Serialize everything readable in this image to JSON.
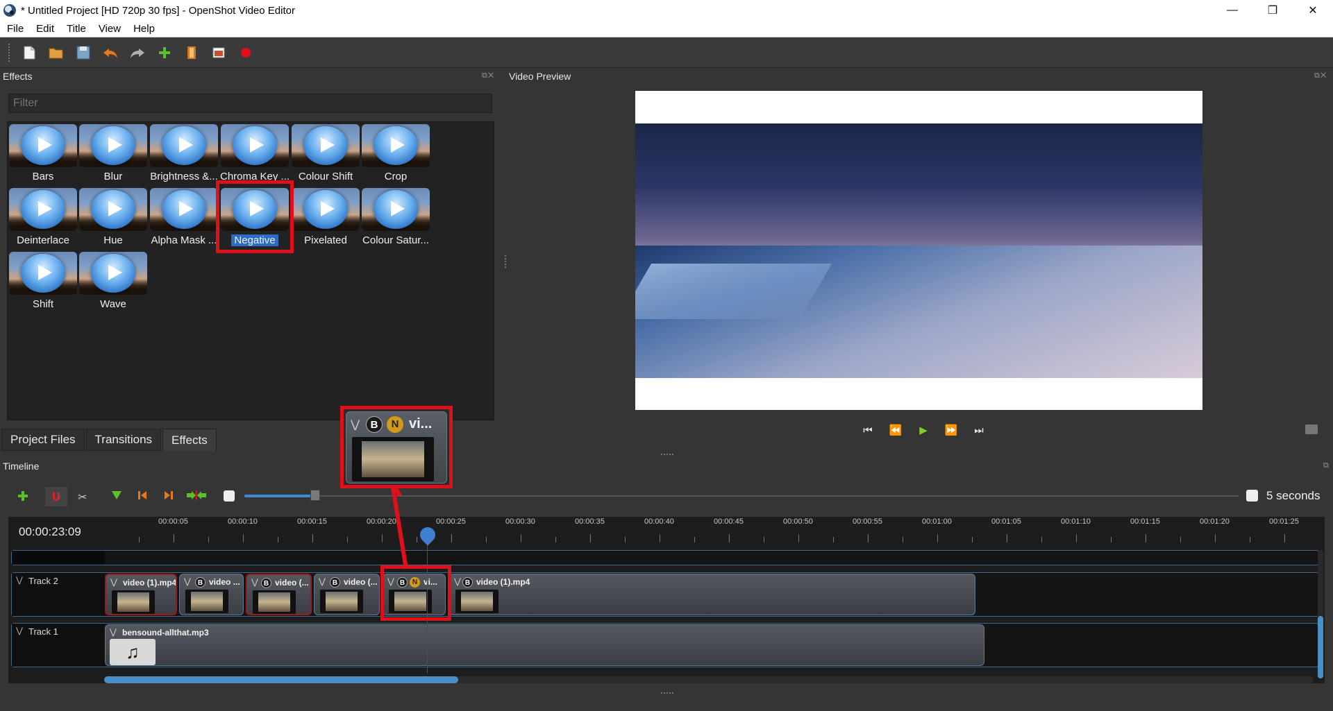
{
  "window": {
    "title": "* Untitled Project [HD 720p 30 fps] - OpenShot Video Editor",
    "controls": [
      "—",
      "❐",
      "✕"
    ]
  },
  "menu": [
    "File",
    "Edit",
    "Title",
    "View",
    "Help"
  ],
  "toolbar_icons": [
    "new-project-icon",
    "open-project-icon",
    "save-project-icon",
    "undo-icon",
    "redo-icon",
    "import-files-icon",
    "profile-icon",
    "fullscreen-icon",
    "export-video-icon"
  ],
  "effects_panel": {
    "title": "Effects",
    "filter_placeholder": "Filter",
    "items": [
      {
        "label": "Bars"
      },
      {
        "label": "Blur"
      },
      {
        "label": "Brightness &..."
      },
      {
        "label": "Chroma Key ..."
      },
      {
        "label": "Colour Shift"
      },
      {
        "label": "Crop"
      },
      {
        "label": "Deinterlace"
      },
      {
        "label": "Hue"
      },
      {
        "label": "Alpha Mask ..."
      },
      {
        "label": "Negative"
      },
      {
        "label": "Pixelated"
      },
      {
        "label": "Colour Satur..."
      },
      {
        "label": "Shift"
      },
      {
        "label": "Wave"
      }
    ],
    "selected": "Negative"
  },
  "tabs": [
    "Project Files",
    "Transitions",
    "Effects"
  ],
  "active_tab": "Effects",
  "preview": {
    "title": "Video Preview"
  },
  "timeline": {
    "title": "Timeline",
    "zoom_label": "5 seconds",
    "current_time": "00:00:23:09",
    "ticks": [
      "00:00:05",
      "00:00:10",
      "00:00:15",
      "00:00:20",
      "00:00:25",
      "00:00:30",
      "00:00:35",
      "00:00:40",
      "00:00:45",
      "00:00:50",
      "00:00:55",
      "00:01:00",
      "00:01:05",
      "00:01:10",
      "00:01:15",
      "00:01:20",
      "00:01:25"
    ],
    "tracks": [
      {
        "name": "Track 2",
        "clips": [
          {
            "name": "video (1).mp4"
          },
          {
            "name": "video ..."
          },
          {
            "name": "video (..."
          },
          {
            "name": "video (..."
          },
          {
            "name": "vi..."
          },
          {
            "name": "video (1).mp4"
          }
        ]
      },
      {
        "name": "Track 1",
        "clips": [
          {
            "name": "bensound-allthat.mp3"
          }
        ]
      }
    ]
  },
  "drag_ghost": {
    "label": "vi...",
    "badges": [
      "B",
      "N"
    ]
  },
  "badge_b": "B",
  "badge_n": "N"
}
